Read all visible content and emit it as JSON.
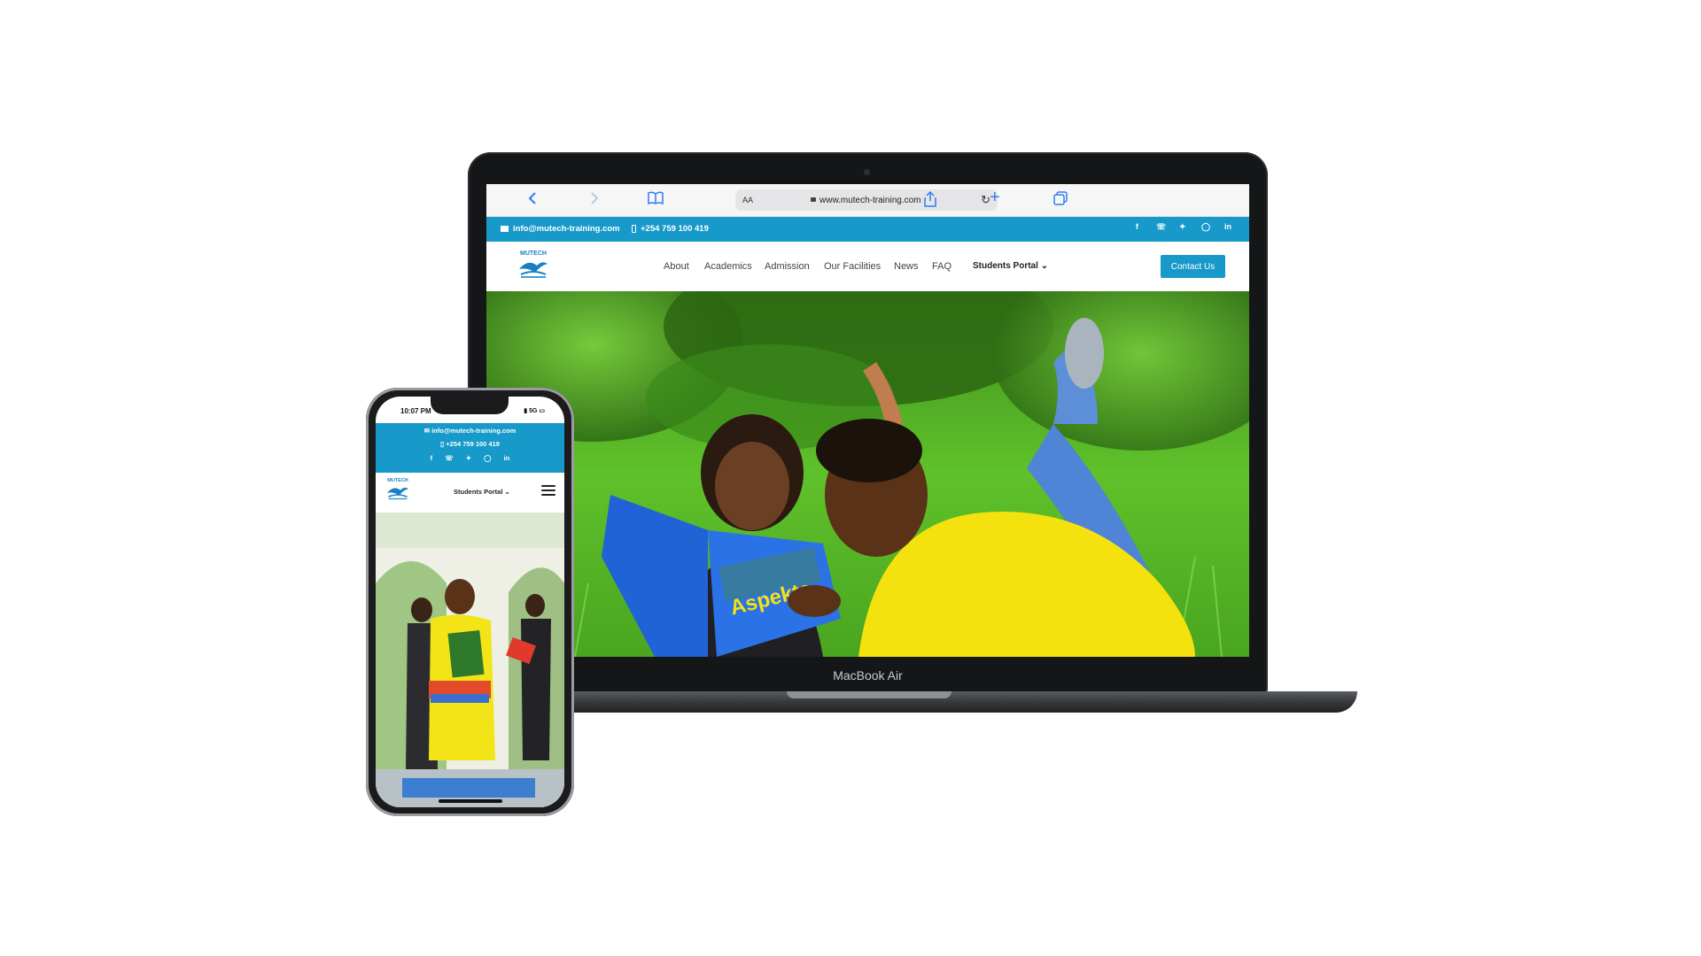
{
  "laptop": {
    "brand_label": "MacBook Air",
    "browser": {
      "reader_label": "AA",
      "url": "www.mutech-training.com"
    },
    "site": {
      "topbar": {
        "email": "info@mutech-training.com",
        "phone": "+254 759 100 419",
        "socials": [
          "facebook-icon",
          "whatsapp-icon",
          "twitter-icon",
          "instagram-icon",
          "linkedin-icon"
        ]
      },
      "logo_text": "MUTECH",
      "nav": [
        "About",
        "Academics",
        "Admission",
        "Our Facilities",
        "News",
        "FAQ"
      ],
      "portal_label": "Students Portal",
      "contact_button": "Contact Us",
      "hero_book_title": "Aspekte"
    }
  },
  "phone": {
    "time": "10:07 PM",
    "network": "5G",
    "email": "info@mutech-training.com",
    "phone": "+254 759 100 419",
    "logo_text": "MUTECH",
    "portal_label": "Students Portal"
  },
  "colors": {
    "brand_blue": "#1799c9",
    "safari_accent": "#2f7cf6"
  }
}
